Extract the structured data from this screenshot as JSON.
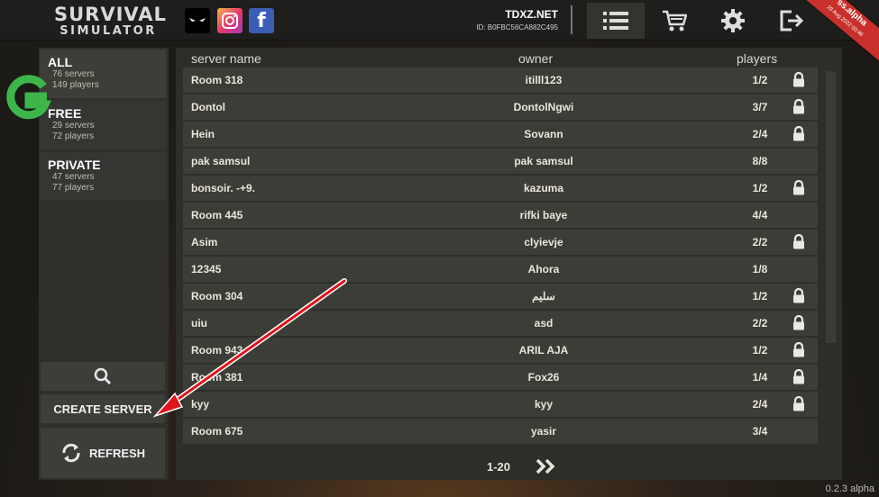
{
  "header": {
    "logo_line1": "SURVIVAL",
    "logo_line2": "SIMULATOR",
    "username": "TDXZ.NET",
    "user_id": "ID: B0FBC56CA882C495",
    "ribbon_title": "ss.alpha",
    "ribbon_sub": "29 Aug 2022 00:46",
    "nav": [
      "servers-list-icon",
      "cart-icon",
      "gear-icon",
      "exit-icon"
    ]
  },
  "categories": [
    {
      "title": "ALL",
      "servers": "76 servers",
      "players": "149 players"
    },
    {
      "title": "FREE",
      "servers": "29 servers",
      "players": "72 players"
    },
    {
      "title": "PRIVATE",
      "servers": "47 servers",
      "players": "77 players"
    }
  ],
  "actions": {
    "create": "CREATE SERVER",
    "refresh": "REFRESH"
  },
  "table": {
    "headers": {
      "name": "server name",
      "owner": "owner",
      "players": "players"
    },
    "rows": [
      {
        "name": "Room 318",
        "owner": "itilll123",
        "players": "1/2",
        "locked": true
      },
      {
        "name": "Dontol",
        "owner": "DontolNgwi",
        "players": "3/7",
        "locked": true
      },
      {
        "name": "Hein",
        "owner": "Sovann",
        "players": "2/4",
        "locked": true
      },
      {
        "name": "pak samsul",
        "owner": "pak samsul",
        "players": "8/8",
        "locked": false
      },
      {
        "name": "bonsoir.        -+9.",
        "owner": "kazuma",
        "players": "1/2",
        "locked": true
      },
      {
        "name": "Room 445",
        "owner": "rifki baye",
        "players": "4/4",
        "locked": false
      },
      {
        "name": "Asim",
        "owner": "clyievje",
        "players": "2/2",
        "locked": true
      },
      {
        "name": "12345",
        "owner": "Ahora",
        "players": "1/8",
        "locked": false
      },
      {
        "name": "Room 304",
        "owner": "سلیم",
        "players": "1/2",
        "locked": true
      },
      {
        "name": "uiu",
        "owner": "asd",
        "players": "2/2",
        "locked": true
      },
      {
        "name": "Room 943",
        "owner": "ARIL AJA",
        "players": "1/2",
        "locked": true
      },
      {
        "name": "Room 381",
        "owner": "Fox26",
        "players": "1/4",
        "locked": true
      },
      {
        "name": "kyy",
        "owner": "kyy",
        "players": "2/4",
        "locked": true
      },
      {
        "name": "Room 675",
        "owner": "yasir",
        "players": "3/4",
        "locked": false
      }
    ],
    "pager": "1-20"
  },
  "version": "0.2.3 alpha",
  "colors": {
    "accent_red": "#e0141b",
    "ribbon": "#c9302c",
    "facebook": "#3b5db5",
    "badge_green": "#3db54a"
  }
}
